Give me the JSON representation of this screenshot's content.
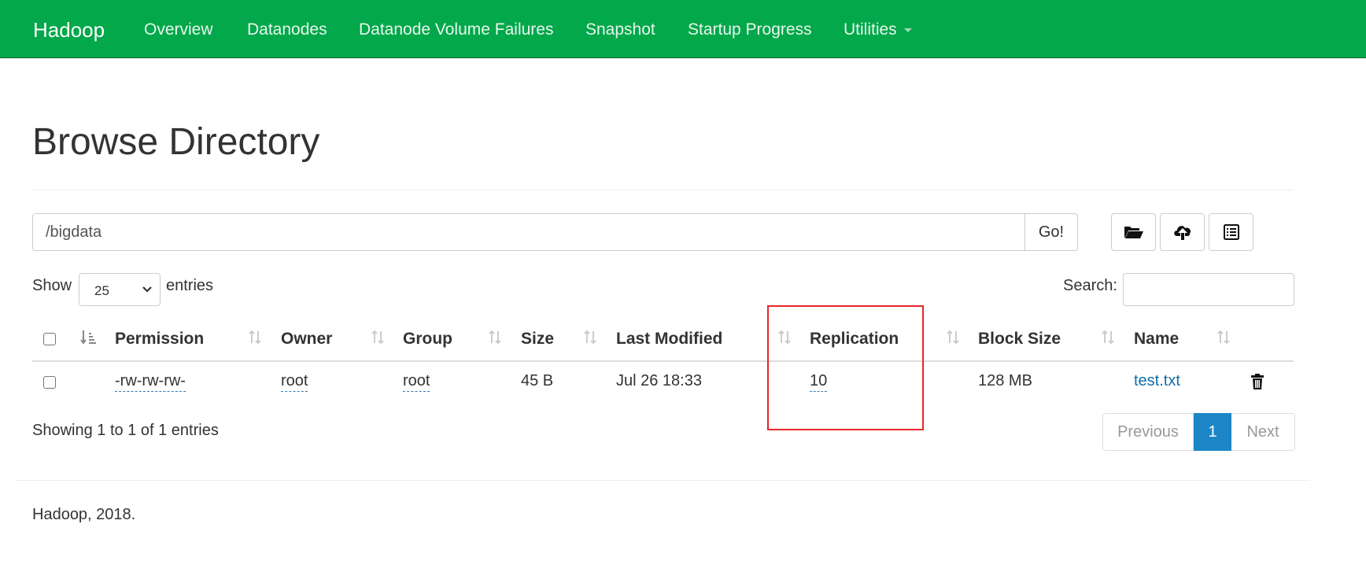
{
  "navbar": {
    "brand": "Hadoop",
    "items": [
      {
        "label": "Overview"
      },
      {
        "label": "Datanodes"
      },
      {
        "label": "Datanode Volume Failures"
      },
      {
        "label": "Snapshot"
      },
      {
        "label": "Startup Progress"
      },
      {
        "label": "Utilities"
      }
    ],
    "color": "#02a84a"
  },
  "page": {
    "title": "Browse Directory"
  },
  "path_bar": {
    "value": "/bigdata",
    "go_label": "Go!",
    "icons": [
      "folder-open-icon",
      "cloud-upload-icon",
      "list-icon"
    ]
  },
  "table_controls": {
    "show_label": "Show",
    "entries_value": "25",
    "entries_label": "entries",
    "search_label": "Search:",
    "search_value": ""
  },
  "table": {
    "columns": [
      "Permission",
      "Owner",
      "Group",
      "Size",
      "Last Modified",
      "Replication",
      "Block Size",
      "Name"
    ],
    "rows": [
      {
        "permission": "-rw-rw-rw-",
        "owner": "root",
        "group": "root",
        "size": "45 B",
        "last_modified": "Jul 26 18:33",
        "replication": "10",
        "block_size": "128 MB",
        "name": "test.txt"
      }
    ]
  },
  "footer_info": {
    "showing": "Showing 1 to 1 of 1 entries"
  },
  "pagination": {
    "previous": "Previous",
    "current": "1",
    "next": "Next",
    "active_color": "#1c86c6"
  },
  "annotation": {
    "highlight_color": "#e8262a"
  },
  "footer": {
    "text": "Hadoop, 2018."
  }
}
